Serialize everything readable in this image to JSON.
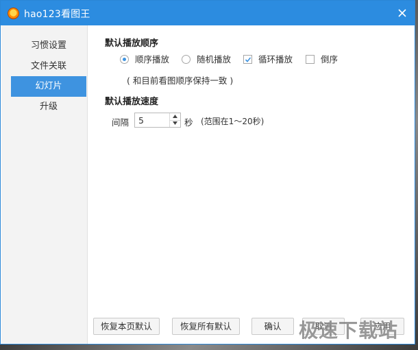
{
  "window": {
    "title": "hao123看图王",
    "accent": "#2c8ce0"
  },
  "sidebar": {
    "items": [
      {
        "label": "习惯设置"
      },
      {
        "label": "文件关联"
      },
      {
        "label": "幻灯片",
        "active": true
      },
      {
        "label": "升级"
      }
    ]
  },
  "order": {
    "title": "默认播放顺序",
    "sequential": {
      "label": "顺序播放",
      "selected": true
    },
    "random": {
      "label": "随机播放",
      "selected": false
    },
    "loop": {
      "label": "循环播放",
      "checked": true
    },
    "reverse": {
      "label": "倒序",
      "checked": false
    },
    "note": "( 和目前看图顺序保持一致 )"
  },
  "speed": {
    "title": "默认播放速度",
    "interval_label": "间隔",
    "value": "5",
    "unit": "秒",
    "range_note": "(范围在1～20秒)"
  },
  "buttons": {
    "restore_page": "恢复本页默认",
    "restore_all": "恢复所有默认",
    "confirm": "确认",
    "cancel": "取消",
    "apply": "应用"
  },
  "watermark": "极速下载站",
  "icons": {
    "app": "hao123-app-icon",
    "close": "close-icon",
    "check": "checkmark-icon"
  }
}
